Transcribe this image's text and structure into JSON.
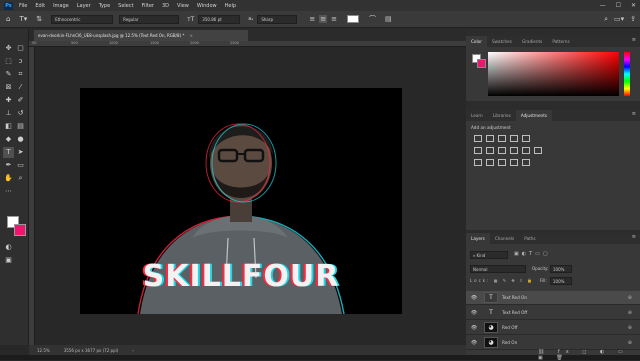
{
  "menu": {
    "logo": "Ps",
    "items": [
      "File",
      "Edit",
      "Image",
      "Layer",
      "Type",
      "Select",
      "Filter",
      "3D",
      "View",
      "Window",
      "Help"
    ],
    "window_buttons": [
      "—",
      "☐",
      "✕"
    ]
  },
  "options_bar": {
    "font_family": "Ethnocentric",
    "font_style": "Regular",
    "font_size": "350.86 pt",
    "antialias": "Sharp"
  },
  "document": {
    "tab_title": "evan-dvorkin-FLhnCl6_UE8-unsplash.jpg @ 12.5% (Text Red On, RGB/8) *",
    "ruler_marks": [
      "50",
      "500",
      "1000",
      "1500",
      "2000",
      "2500"
    ],
    "canvas_text": "SKILLFOUR"
  },
  "status": {
    "zoom": "12.5%",
    "doc_size": "3556 px x 3677 px (72 ppi)"
  },
  "color_panel": {
    "tabs": [
      "Color",
      "Swatches",
      "Gradients",
      "Patterns"
    ],
    "active_tab": "Color",
    "foreground": "#ffffff",
    "background": "#e8176f",
    "field_hue": "#ff0000"
  },
  "adjustments_panel": {
    "tabs": [
      "Learn",
      "Libraries",
      "Adjustments"
    ],
    "active_tab": "Adjustments",
    "heading": "Add an adjustment"
  },
  "layers_panel": {
    "tabs": [
      "Layers",
      "Channels",
      "Paths"
    ],
    "active_tab": "Layers",
    "filter_kind": "Kind",
    "blend_mode": "Normal",
    "opacity_label": "Opacity:",
    "opacity_value": "100%",
    "fill_label": "Fill:",
    "fill_value": "100%",
    "layers": [
      {
        "name": "Text Red On",
        "kind": "text",
        "selected": true
      },
      {
        "name": "Text Red Off",
        "kind": "text",
        "selected": false
      },
      {
        "name": "Red Off",
        "kind": "image",
        "selected": false
      },
      {
        "name": "Red On",
        "kind": "image",
        "selected": false
      }
    ]
  }
}
